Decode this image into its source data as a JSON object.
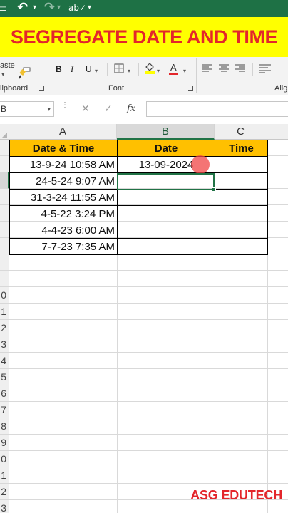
{
  "quick_access": {
    "save_icon": "save-icon",
    "undo_icon": "undo-icon",
    "redo_icon": "redo-icon",
    "spelling_icon": "spelling-check-icon",
    "customize_icon": "customize-toolbar-icon",
    "undo_glyph": "↶",
    "redo_glyph": "↷",
    "spell_glyph": "ab✓",
    "save_glyph": "▭"
  },
  "banner": {
    "text": "SEGREGATE DATE AND TIME",
    "text_color": "#e3262b",
    "background": "#ffff00"
  },
  "ribbon": {
    "clipboard": {
      "paste_label": "aste",
      "group_label": "lipboard"
    },
    "font": {
      "group_label": "Font",
      "bold": "B",
      "italic": "I",
      "underline": "U",
      "font_color_letter": "A",
      "fill_color": "#ffff00",
      "font_color": "#e3262b"
    },
    "alignment": {
      "group_label": "Alig"
    }
  },
  "formula_bar": {
    "name_box_value": "B",
    "cancel_glyph": "✕",
    "enter_glyph": "✓",
    "fx_label": "fx",
    "formula_value": ""
  },
  "sheet": {
    "columns": [
      "A",
      "B",
      "C"
    ],
    "selected_column": "B",
    "row_numbers": [
      "",
      "",
      "",
      "",
      "",
      "",
      "",
      "",
      "",
      "0",
      "1",
      "2",
      "3",
      "4",
      "5",
      "6",
      "7",
      "8",
      "9",
      "0",
      "1",
      "2",
      "3"
    ],
    "headers": {
      "a": "Date & Time",
      "b": "Date",
      "c": "Time"
    },
    "header_fill": "#ffc000",
    "rows": [
      {
        "a": "13-9-24 10:58 AM",
        "b": "13-09-2024",
        "c": ""
      },
      {
        "a": "24-5-24 9:07 AM",
        "b": "",
        "c": ""
      },
      {
        "a": "31-3-24 11:55 AM",
        "b": "",
        "c": ""
      },
      {
        "a": "4-5-22 3:24 PM",
        "b": "",
        "c": ""
      },
      {
        "a": "4-4-23 6:00 AM",
        "b": "",
        "c": ""
      },
      {
        "a": "7-7-23 7:35 AM",
        "b": "",
        "c": ""
      }
    ],
    "accent_color": "#217346"
  },
  "watermark": "ASG EDUTECH"
}
